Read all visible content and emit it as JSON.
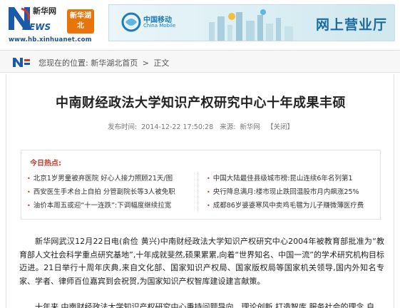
{
  "header": {
    "brand_cn": "新华网",
    "brand_news": "NEWS",
    "hubei_badge": "新华湖北",
    "site_url": "www.hb.xinhuanet.com",
    "banner": {
      "operator_cn": "中国移动",
      "operator_en": "China Mobile",
      "title": "网上营业厅"
    }
  },
  "breadcrumb": {
    "prefix": "您现在的位置:",
    "items": [
      "新华湖北首页",
      "正文"
    ],
    "separator": ">"
  },
  "article": {
    "title": "中南财经政法大学知识产权研究中心十年成果丰硕",
    "meta": {
      "publish_label": "发布时间:",
      "publish_time": "2014-12-22 17:50:28",
      "source_label": "来源:",
      "source": "新华网",
      "close_link": "【关闭】"
    },
    "hot": {
      "title": "今日热点:",
      "left": [
        "北京1岁男童被弃医院 好心人接力照顾21天/图",
        "西安医生手术台上自拍 分管副院长等3人被免职",
        "油价本周五或迎“十一连跌”:下调幅度继续拉宽"
      ],
      "right": [
        "中国大陆最佳县级城市榜:昆山连续6年名列第1",
        "央行降息满月:楼市现止跌回温股市月内飙涨25%",
        "成都86岁婆婆寒风中卖鸡毛毽为儿子赚微薄医疗费"
      ]
    },
    "paragraph1": "新华网武汉12月22日电(俞俭 黄兴)中南财经政法大学知识产权研究中心2004年被教育部批准为“教育部人文社会科学重点研究基地”,十年成就斐然,硕果累累,向着“世界知名、中国一流”的学术研究机构目标迈进。21日举行十周年庆典,来自文化部、国家知识产权局、国家版权局等国家机关领导,国内外知名专家、学者、律师百位嘉宾到会祝贺,为国家知识产权智库建设建言献策。",
    "paragraph2": "十年来,中南财经政法大学知识产权研究中心秉持问题导向、理论创新,打造智库,服务社会的理念,自"
  },
  "colors": {
    "accent_red": "#c0392b",
    "brand_blue": "#1a5aa8",
    "hubei_orange": "#e8740a",
    "banner_blue": "#1b6b9e"
  }
}
